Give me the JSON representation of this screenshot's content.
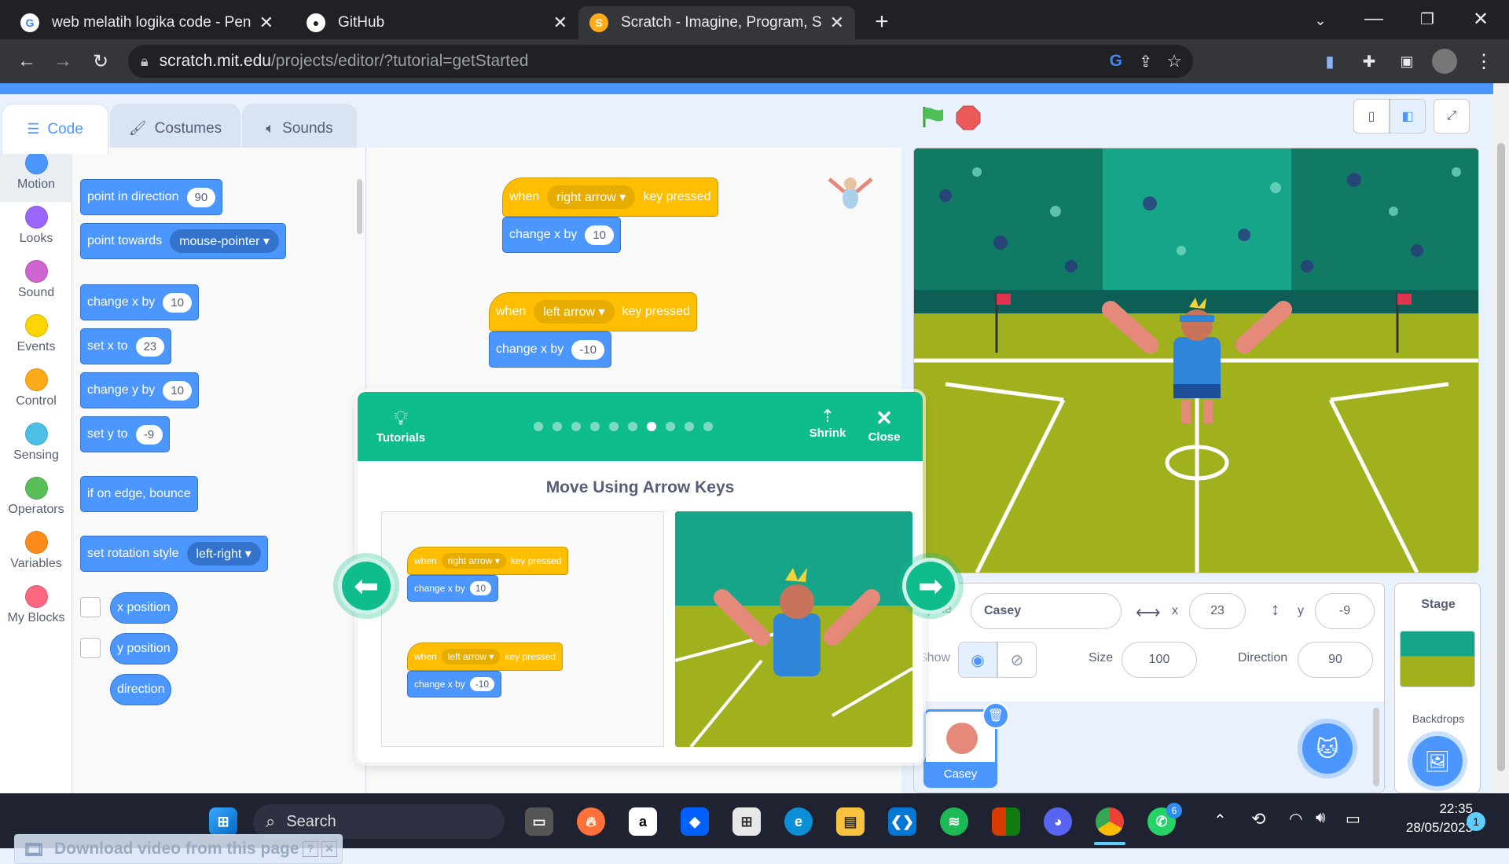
{
  "browser": {
    "tabs": [
      {
        "title": "web melatih logika code - Penelu",
        "icon": "google-icon"
      },
      {
        "title": "GitHub",
        "icon": "github-icon"
      },
      {
        "title": "Scratch - Imagine, Program, Shar",
        "icon": "scratch-icon"
      }
    ],
    "url_host": "scratch.mit.edu",
    "url_path": "/projects/editor/?tutorial=getStarted"
  },
  "editor": {
    "tabs": {
      "code": "Code",
      "costumes": "Costumes",
      "sounds": "Sounds"
    },
    "categories": [
      {
        "label": "Motion",
        "color": "#4c97ff"
      },
      {
        "label": "Looks",
        "color": "#9966ff"
      },
      {
        "label": "Sound",
        "color": "#cf63cf"
      },
      {
        "label": "Events",
        "color": "#ffd500"
      },
      {
        "label": "Control",
        "color": "#ffab19"
      },
      {
        "label": "Sensing",
        "color": "#4cbfe6"
      },
      {
        "label": "Operators",
        "color": "#59c059"
      },
      {
        "label": "Variables",
        "color": "#ff8c1a"
      },
      {
        "label": "My Blocks",
        "color": "#ff6680"
      }
    ],
    "palette": {
      "point_dir": "point in direction",
      "point_dir_val": "90",
      "point_towards": "point towards",
      "point_towards_val": "mouse-pointer",
      "change_x": "change x by",
      "change_x_val": "10",
      "set_x": "set x to",
      "set_x_val": "23",
      "change_y": "change y by",
      "change_y_val": "10",
      "set_y": "set y to",
      "set_y_val": "-9",
      "bounce": "if on edge, bounce",
      "rot_style": "set rotation style",
      "rot_style_val": "left-right",
      "x_pos": "x position",
      "y_pos": "y position",
      "direction": "direction"
    },
    "scripts": [
      {
        "when": "when",
        "key": "right arrow",
        "pressed": "key pressed",
        "change": "change x by",
        "val": "10"
      },
      {
        "when": "when",
        "key": "left arrow",
        "pressed": "key pressed",
        "change": "change x by",
        "val": "-10"
      }
    ]
  },
  "tutorial": {
    "tutorials_label": "Tutorials",
    "shrink_label": "Shrink",
    "close_label": "Close",
    "title": "Move Using Arrow Keys",
    "steps_total": 10,
    "current_step": 7
  },
  "stage": {
    "sprite_label": "Sprite",
    "sprite_name": "Casey",
    "x_label": "x",
    "x_val": "23",
    "y_label": "y",
    "y_val": "-9",
    "show_label": "Show",
    "size_label": "Size",
    "size_val": "100",
    "direction_label": "Direction",
    "direction_val": "90",
    "sprite_thumb_label": "Casey",
    "stage_label": "Stage",
    "backdrops_label": "Backdrops"
  },
  "overlay": {
    "download": "Download video from this page"
  },
  "taskbar": {
    "search": "Search",
    "time": "22:35",
    "date": "28/05/2023",
    "notif": "1",
    "whatsapp_badge": "6"
  }
}
